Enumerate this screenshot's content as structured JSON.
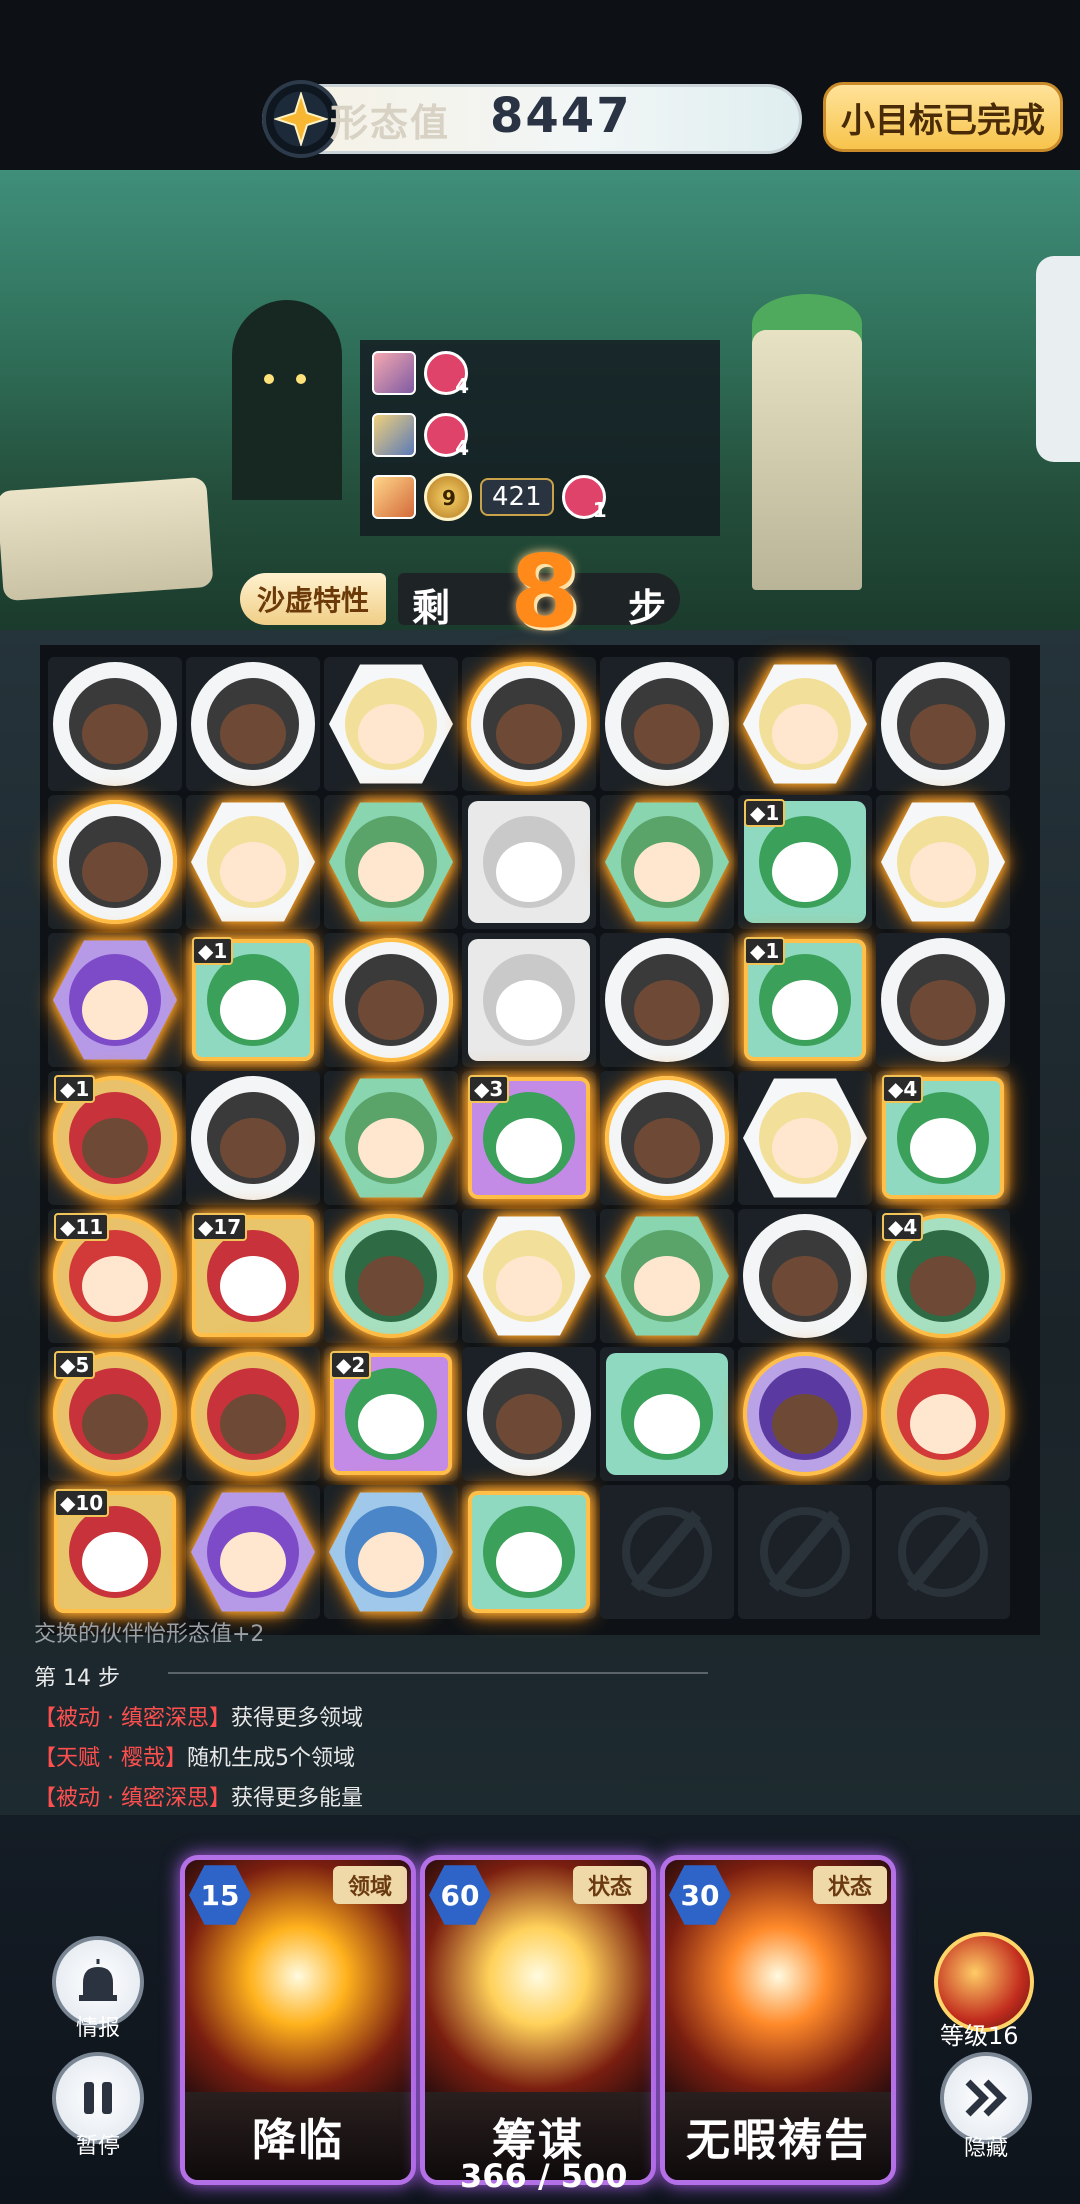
{
  "header": {
    "score_label": "形态值",
    "score_value": "8447",
    "goal_button": "小目标已完成"
  },
  "buffs": [
    {
      "count": "4"
    },
    {
      "count": "4"
    },
    {
      "level": "9",
      "value": "421",
      "count": "1"
    }
  ],
  "steps": {
    "trait_button": "沙虚特性",
    "prefix": "剩",
    "remaining": "8",
    "suffix": "步"
  },
  "board": {
    "columns": 7,
    "rows": 7,
    "tiles": [
      [
        {
          "shape": "circle",
          "char": "ox"
        },
        {
          "shape": "circle",
          "char": "ox"
        },
        {
          "shape": "hex",
          "char": "blonde"
        },
        {
          "shape": "circle",
          "char": "ox",
          "glow": true
        },
        {
          "shape": "circle",
          "char": "ox"
        },
        {
          "shape": "hex",
          "char": "blonde",
          "glow": true
        },
        {
          "shape": "circle",
          "char": "ox"
        }
      ],
      [
        {
          "shape": "circle",
          "char": "ox",
          "glow": true
        },
        {
          "shape": "hex",
          "char": "blonde",
          "glow": true
        },
        {
          "shape": "hex",
          "char": "green-elf",
          "glow": true
        },
        {
          "shape": "square",
          "char": "white-dog"
        },
        {
          "shape": "hex",
          "char": "green-elf",
          "glow": true
        },
        {
          "shape": "square",
          "char": "green-dog",
          "badge": "1"
        },
        {
          "shape": "hex",
          "char": "blonde",
          "glow": true
        }
      ],
      [
        {
          "shape": "hex",
          "char": "purple-knight",
          "glow": true
        },
        {
          "shape": "square",
          "char": "green-dog",
          "badge": "1",
          "glow": true
        },
        {
          "shape": "circle",
          "char": "ox",
          "glow": true
        },
        {
          "shape": "square",
          "char": "white-dog"
        },
        {
          "shape": "circle",
          "char": "ox"
        },
        {
          "shape": "square",
          "char": "green-dog",
          "badge": "1",
          "glow": true
        },
        {
          "shape": "circle",
          "char": "ox"
        }
      ],
      [
        {
          "shape": "circle",
          "char": "red-ox",
          "badge": "1",
          "glow": true
        },
        {
          "shape": "circle",
          "char": "ox"
        },
        {
          "shape": "hex",
          "char": "green-elf",
          "glow": true
        },
        {
          "shape": "square",
          "char": "purple-dog",
          "badge": "3",
          "glow": true
        },
        {
          "shape": "circle",
          "char": "ox",
          "glow": true
        },
        {
          "shape": "hex",
          "char": "blonde"
        },
        {
          "shape": "square",
          "char": "green-dog",
          "badge": "4",
          "glow": true
        }
      ],
      [
        {
          "shape": "circle",
          "char": "red-knight",
          "badge": "11",
          "glow": true
        },
        {
          "shape": "square",
          "char": "red-dog",
          "badge": "17",
          "glow": true
        },
        {
          "shape": "circle",
          "char": "green-ox",
          "glow": true
        },
        {
          "shape": "hex",
          "char": "blonde",
          "glow": true
        },
        {
          "shape": "hex",
          "char": "green-elf",
          "glow": true
        },
        {
          "shape": "circle",
          "char": "ox"
        },
        {
          "shape": "circle",
          "char": "green-ox",
          "badge": "4",
          "glow": true
        }
      ],
      [
        {
          "shape": "circle",
          "char": "red-ox",
          "badge": "5",
          "glow": true
        },
        {
          "shape": "circle",
          "char": "red-ox",
          "glow": true
        },
        {
          "shape": "square",
          "char": "purple-dog",
          "badge": "2",
          "glow": true
        },
        {
          "shape": "circle",
          "char": "ox"
        },
        {
          "shape": "square",
          "char": "green-dog"
        },
        {
          "shape": "circle",
          "char": "purple-ox",
          "glow": true
        },
        {
          "shape": "circle",
          "char": "red-knight",
          "glow": true
        }
      ],
      [
        {
          "shape": "square",
          "char": "red-dog",
          "badge": "10",
          "glow": true
        },
        {
          "shape": "hex",
          "char": "purple-knight",
          "glow": true
        },
        {
          "shape": "hex",
          "char": "blue-knight",
          "glow": true
        },
        {
          "shape": "square",
          "char": "green-dog",
          "glow": true
        },
        {
          "shape": "lock"
        },
        {
          "shape": "lock"
        },
        {
          "shape": "lock"
        }
      ]
    ]
  },
  "log": {
    "partial_line": "交换的伙伴怡形态值+2",
    "step_title": "第 14 步",
    "entries": [
      {
        "tag": "【被动 · 缜密深思】",
        "text": "获得更多领域"
      },
      {
        "tag": "【天赋 · 樱哉】",
        "text": "随机生成5个领域"
      },
      {
        "tag": "【被动 · 缜密深思】",
        "text": "获得更多能量"
      }
    ]
  },
  "controls": {
    "info_label": "情报",
    "pause_label": "暂停",
    "hide_label": "隐藏",
    "level_label": "等级16"
  },
  "skills": [
    {
      "cost": "15",
      "type": "领域",
      "name": "降临",
      "color": "#ffb21d"
    },
    {
      "cost": "60",
      "type": "状态",
      "name": "筹谋",
      "color": "#ffd15a"
    },
    {
      "cost": "30",
      "type": "状态",
      "name": "无暇祷告",
      "color": "#ff8a2a"
    }
  ],
  "energy": {
    "current": "366",
    "max": "500",
    "text": "366 / 500"
  },
  "colors": {
    "accent_orange": "#ff8a1a",
    "card_border": "#b470e6",
    "glow": "#ffb23a"
  }
}
